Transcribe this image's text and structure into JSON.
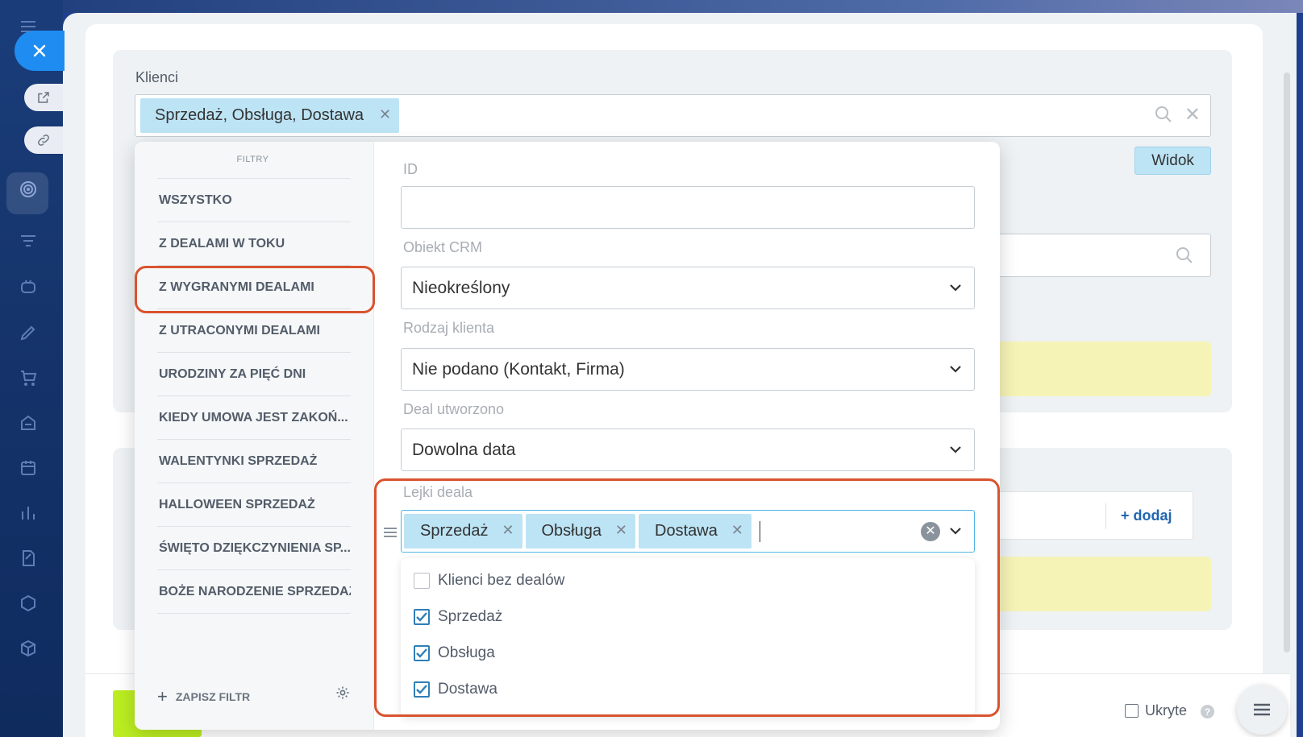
{
  "main_filter": {
    "label": "Klienci",
    "preset_tag": "Sprzedaż, Obsługa, Dostawa"
  },
  "view_button": "Widok",
  "add_link": "+ dodaj",
  "footer": {
    "hidden_label": "Ukryte",
    "help": "?"
  },
  "presets": {
    "title": "FILTRY",
    "items": [
      "WSZYSTKO",
      "Z DEALAMI W TOKU",
      "Z WYGRANYMI DEALAMI",
      "Z UTRACONYMI DEALAMI",
      "URODZINY ZA PIĘĆ DNI",
      "KIEDY UMOWA JEST ZAKOŃ...",
      "WALENTYNKI SPRZEDAŻ",
      "HALLOWEEN SPRZEDAŻ",
      "ŚWIĘTO DZIĘKCZYNIENIA SP...",
      "BOŻE NARODZENIE SPRZEDAŻ"
    ],
    "save_label": "ZAPISZ FILTR"
  },
  "fields": {
    "id": {
      "label": "ID",
      "value": ""
    },
    "crm_object": {
      "label": "Obiekt CRM",
      "value": "Nieokreślony"
    },
    "client_type": {
      "label": "Rodzaj klienta",
      "value": "Nie podano (Kontakt, Firma)"
    },
    "deal_created": {
      "label": "Deal utworzono",
      "value": "Dowolna data"
    },
    "deal_funnels": {
      "label": "Lejki deala",
      "tags": [
        "Sprzedaż",
        "Obsługa",
        "Dostawa"
      ],
      "options": [
        {
          "label": "Klienci bez dealów",
          "checked": false
        },
        {
          "label": "Sprzedaż",
          "checked": true
        },
        {
          "label": "Obsługa",
          "checked": true
        },
        {
          "label": "Dostawa",
          "checked": true
        }
      ]
    }
  },
  "colors": {
    "tag_bg": "#bde4f5",
    "highlight": "#d9532f",
    "accent_blue": "#1e8cf0",
    "primary_green": "#bbed21",
    "notice_yellow": "#f6f3b7"
  }
}
